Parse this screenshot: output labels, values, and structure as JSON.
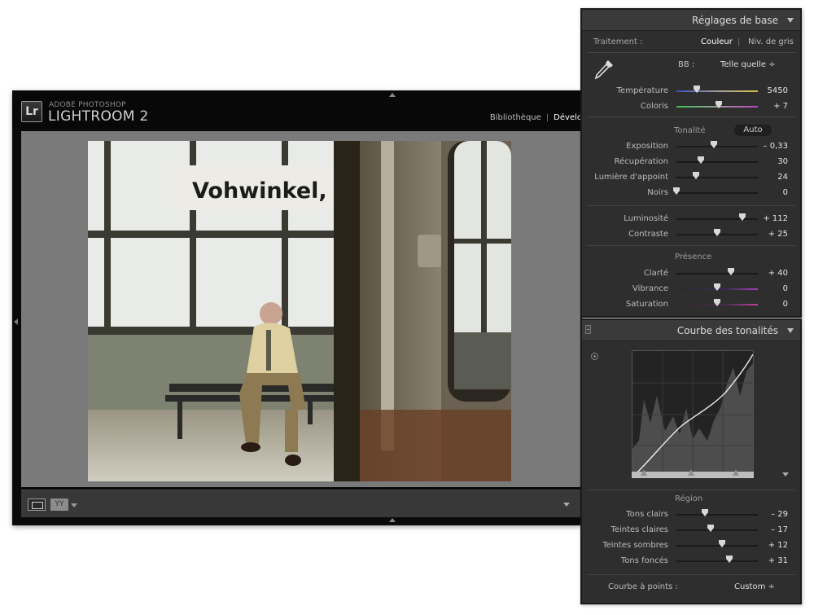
{
  "app": {
    "brand_top": "ADOBE PHOTOSHOP",
    "brand_main": "LIGHTROOM 2",
    "logo": "Lr",
    "modules": [
      "Bibliothèque",
      "Dévelo"
    ],
    "active_module": "Dévelo"
  },
  "photo": {
    "sign_text": "Vohwinkel, Sch"
  },
  "toolbar": {
    "loupe_icon": "single-view-icon",
    "compare_label": "YY"
  },
  "basic_panel": {
    "title": "Réglages de base",
    "treatment_label": "Traitement :",
    "treatment_color": "Couleur",
    "treatment_sep": "|",
    "treatment_gray": "Niv. de gris",
    "wb_label": "BB :",
    "wb_value": "Telle quelle ÷",
    "white_balance": [
      {
        "label": "Température",
        "value": "5450",
        "pos": 0.25
      },
      {
        "label": "Coloris",
        "value": "+ 7",
        "pos": 0.52
      }
    ],
    "tone_label": "Tonalité",
    "auto_label": "Auto",
    "tone": [
      {
        "label": "Exposition",
        "value": "– 0,33",
        "pos": 0.46
      },
      {
        "label": "Récupération",
        "value": "30",
        "pos": 0.3
      },
      {
        "label": "Lumière d'appoint",
        "value": "24",
        "pos": 0.24
      },
      {
        "label": "Noirs",
        "value": "0",
        "pos": 0.0
      }
    ],
    "tone2": [
      {
        "label": "Luminosité",
        "value": "+ 112",
        "pos": 0.81
      },
      {
        "label": "Contraste",
        "value": "+ 25",
        "pos": 0.5
      }
    ],
    "presence_label": "Présence",
    "presence": [
      {
        "label": "Clarté",
        "value": "+ 40",
        "pos": 0.67
      },
      {
        "label": "Vibrance",
        "value": "0",
        "pos": 0.5
      },
      {
        "label": "Saturation",
        "value": "0",
        "pos": 0.5
      }
    ]
  },
  "curve_panel": {
    "title": "Courbe des tonalités",
    "region_label": "Région",
    "region": [
      {
        "label": "Tons clairs",
        "value": "– 29",
        "pos": 0.35
      },
      {
        "label": "Teintes claires",
        "value": "– 17",
        "pos": 0.42
      },
      {
        "label": "Teintes sombres",
        "value": "+ 12",
        "pos": 0.56
      },
      {
        "label": "Tons foncés",
        "value": "+ 31",
        "pos": 0.65
      }
    ],
    "point_curve_label": "Courbe à points :",
    "point_curve_value": "Custom ÷"
  }
}
